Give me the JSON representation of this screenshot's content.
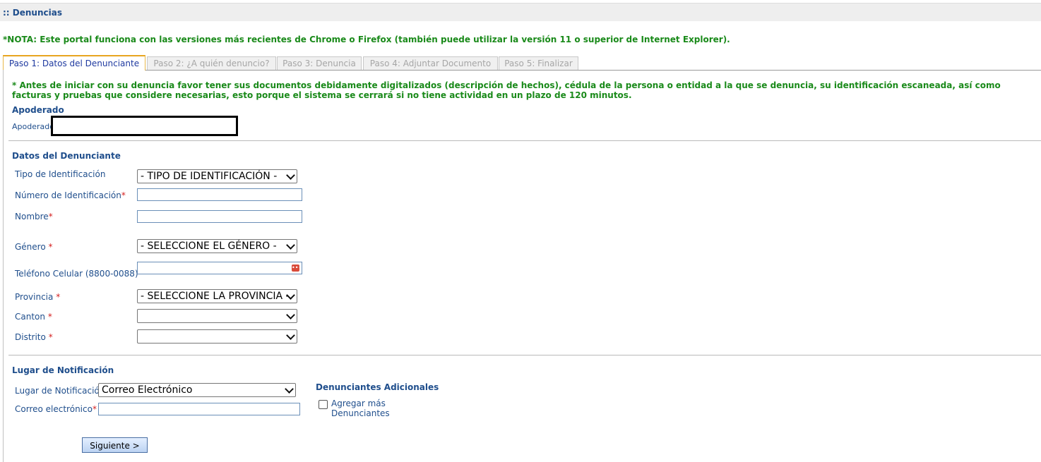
{
  "header": {
    "title": ":: Denuncias"
  },
  "nota": "*NOTA: Este portal funciona con las versiones más recientes de Chrome o Firefox (también puede utilizar la versión 11 o superior de Internet Explorer).",
  "tabs": [
    {
      "label": "Paso 1: Datos del Denunciante",
      "active": true
    },
    {
      "label": "Paso 2: ¿A quién denuncio?",
      "active": false
    },
    {
      "label": "Paso 3: Denuncia",
      "active": false
    },
    {
      "label": "Paso 4: Adjuntar Documento",
      "active": false
    },
    {
      "label": "Paso 5: Finalizar",
      "active": false
    }
  ],
  "warning": "* Antes de iniciar con su denuncia favor tener sus documentos debidamente digitalizados (descripción de hechos), cédula de la persona o entidad a la que se denuncia, su identificación escaneada, así como facturas y pruebas que considere necesarias, esto porque el sistema se cerrará si no tiene actividad en un plazo de 120 minutos.",
  "apoderado": {
    "section": "Apoderado",
    "label": "Apoderado"
  },
  "denunciante": {
    "section": "Datos del Denunciante",
    "tipo_label": "Tipo de Identificación",
    "tipo_value": "- TIPO DE IDENTIFICACIÓN -",
    "numero_label": "Número de Identificación",
    "nombre_label": "Nombre",
    "genero_label": "Género",
    "genero_value": "- SELECCIONE EL GÉNERO -",
    "telefono_label": "Teléfono Celular (8800-0088)",
    "provincia_label": "Provincia",
    "provincia_value": "- SELECCIONE LA PROVINCIA -",
    "canton_label": "Canton",
    "distrito_label": "Distrito",
    "required_mark": "*"
  },
  "notificacion": {
    "section": "Lugar de Notificación",
    "lugar_label": "Lugar de Notificación",
    "lugar_value": "Correo Electrónico",
    "correo_label": "Correo electrónico"
  },
  "adicionales": {
    "section": "Denunciantes Adicionales",
    "checkbox_label_1": "Agregar más",
    "checkbox_label_2": "Denunciantes"
  },
  "buttons": {
    "next": "Siguiente >"
  }
}
